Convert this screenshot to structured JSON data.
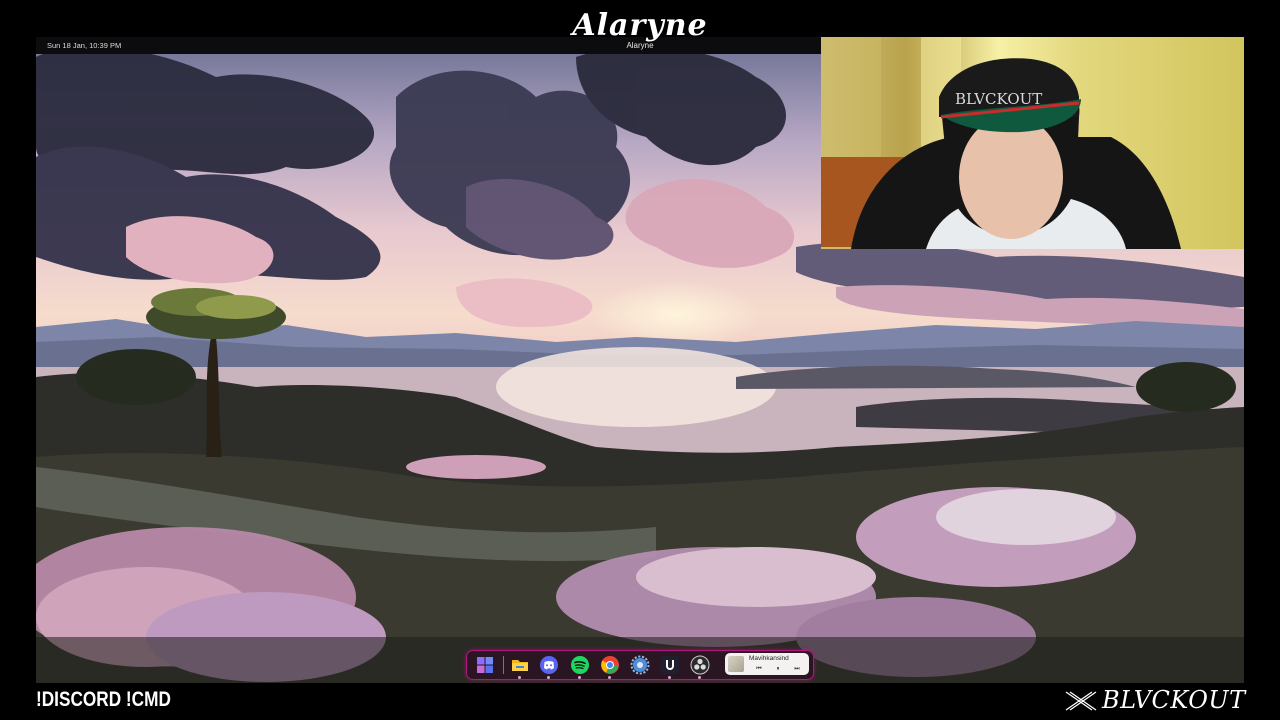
{
  "overlay": {
    "brand_script": "Alaryne",
    "window_title": "Alaryne",
    "commands": "!DISCORD !CMD",
    "brand_name": "BLVCKOUT"
  },
  "system": {
    "clock": "Sun 18 Jan, 10:39 PM",
    "power_icon": "power-icon"
  },
  "webcam": {
    "cap_text": "BLVCKOUT"
  },
  "dock": {
    "items": [
      {
        "name": "windows-start-icon",
        "color": "#7b59ff"
      },
      {
        "name": "file-explorer-icon",
        "color": "#f2b817"
      },
      {
        "name": "discord-icon",
        "color": "#5865f2"
      },
      {
        "name": "spotify-icon",
        "color": "#1ed760"
      },
      {
        "name": "chrome-icon",
        "color": "#e94235"
      },
      {
        "name": "settings-icon",
        "color": "#4f8ed9"
      },
      {
        "name": "ubisoft-icon",
        "color": "#1f1f2f"
      },
      {
        "name": "obs-icon",
        "color": "#2b2b2b"
      }
    ],
    "media": {
      "title": "Mavihkansind",
      "prev": "⏮",
      "play": "⏸",
      "next": "⏭"
    }
  },
  "colors": {
    "dock_border": "#b2157c",
    "sky_top": "#6b6f92",
    "sunset": "#f6dccd"
  }
}
